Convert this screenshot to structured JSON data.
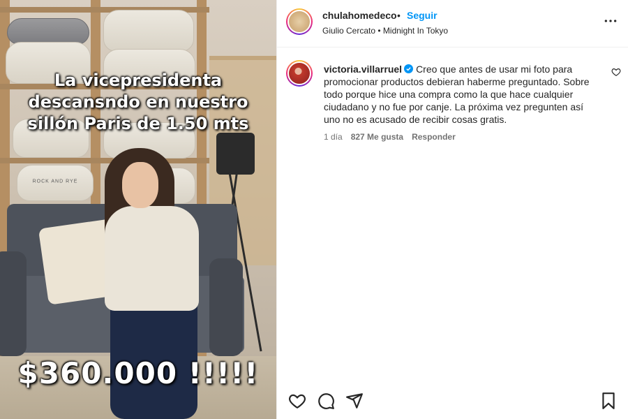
{
  "media": {
    "caption_line1": "La vicepresidenta",
    "caption_line2": "descansndo en nuestro",
    "caption_line3": "sillón Paris de 1.50 mts",
    "price": "$360.000 !!!!!",
    "pillow_tag": "ROCK AND RYE"
  },
  "header": {
    "username": "chulahomedeco",
    "separator": "•",
    "follow_label": "Seguir",
    "audio": "Giulio Cercato • Midnight In Tokyo"
  },
  "comment": {
    "username": "victoria.villarruel",
    "text": "Creo que antes de usar mi foto para promocionar productos debieran haberme preguntado. Sobre todo porque hice una compra como la que hace cualquier ciudadano y no fue por canje. La próxima vez pregunten así uno no es acusado de recibir cosas gratis.",
    "time": "1 día",
    "likes": "827 Me gusta",
    "reply_label": "Responder"
  },
  "colors": {
    "follow_blue": "#0095f6",
    "text": "#262626",
    "muted": "#737373"
  },
  "icons": {
    "more": "more-horizontal-icon",
    "heart": "heart-icon",
    "comment": "comment-icon",
    "share": "share-icon",
    "save": "bookmark-icon",
    "verified": "verified-badge-icon"
  }
}
